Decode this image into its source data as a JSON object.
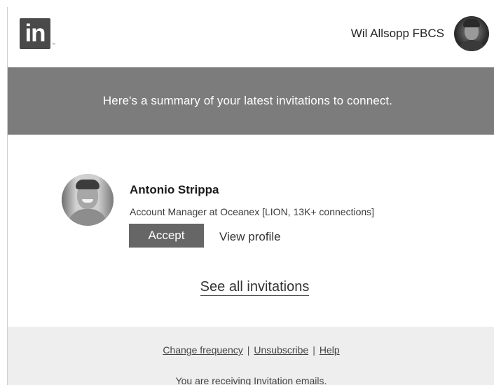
{
  "header": {
    "logo_text": "in",
    "logo_mark": "™",
    "user_name": "Wil Allsopp FBCS",
    "icons": {
      "logo": "linkedin-logo-icon",
      "avatar": "user-avatar"
    }
  },
  "banner": {
    "text": "Here's a summary of your latest invitations to connect."
  },
  "invitation": {
    "name": "Antonio Strippa",
    "headline": "Account Manager at Oceanex [LION, 13K+ connections]",
    "accept_label": "Accept",
    "view_profile_label": "View profile"
  },
  "see_all_label": "See all invitations",
  "footer": {
    "links": [
      "Change frequency",
      "Unsubscribe",
      "Help"
    ],
    "separator": "|",
    "note": "You are receiving Invitation emails."
  },
  "colors": {
    "banner_bg": "#7c7c7c",
    "accept_bg": "#666666",
    "footer_bg": "#eeeeee",
    "logo_bg": "#4a4a4a"
  }
}
